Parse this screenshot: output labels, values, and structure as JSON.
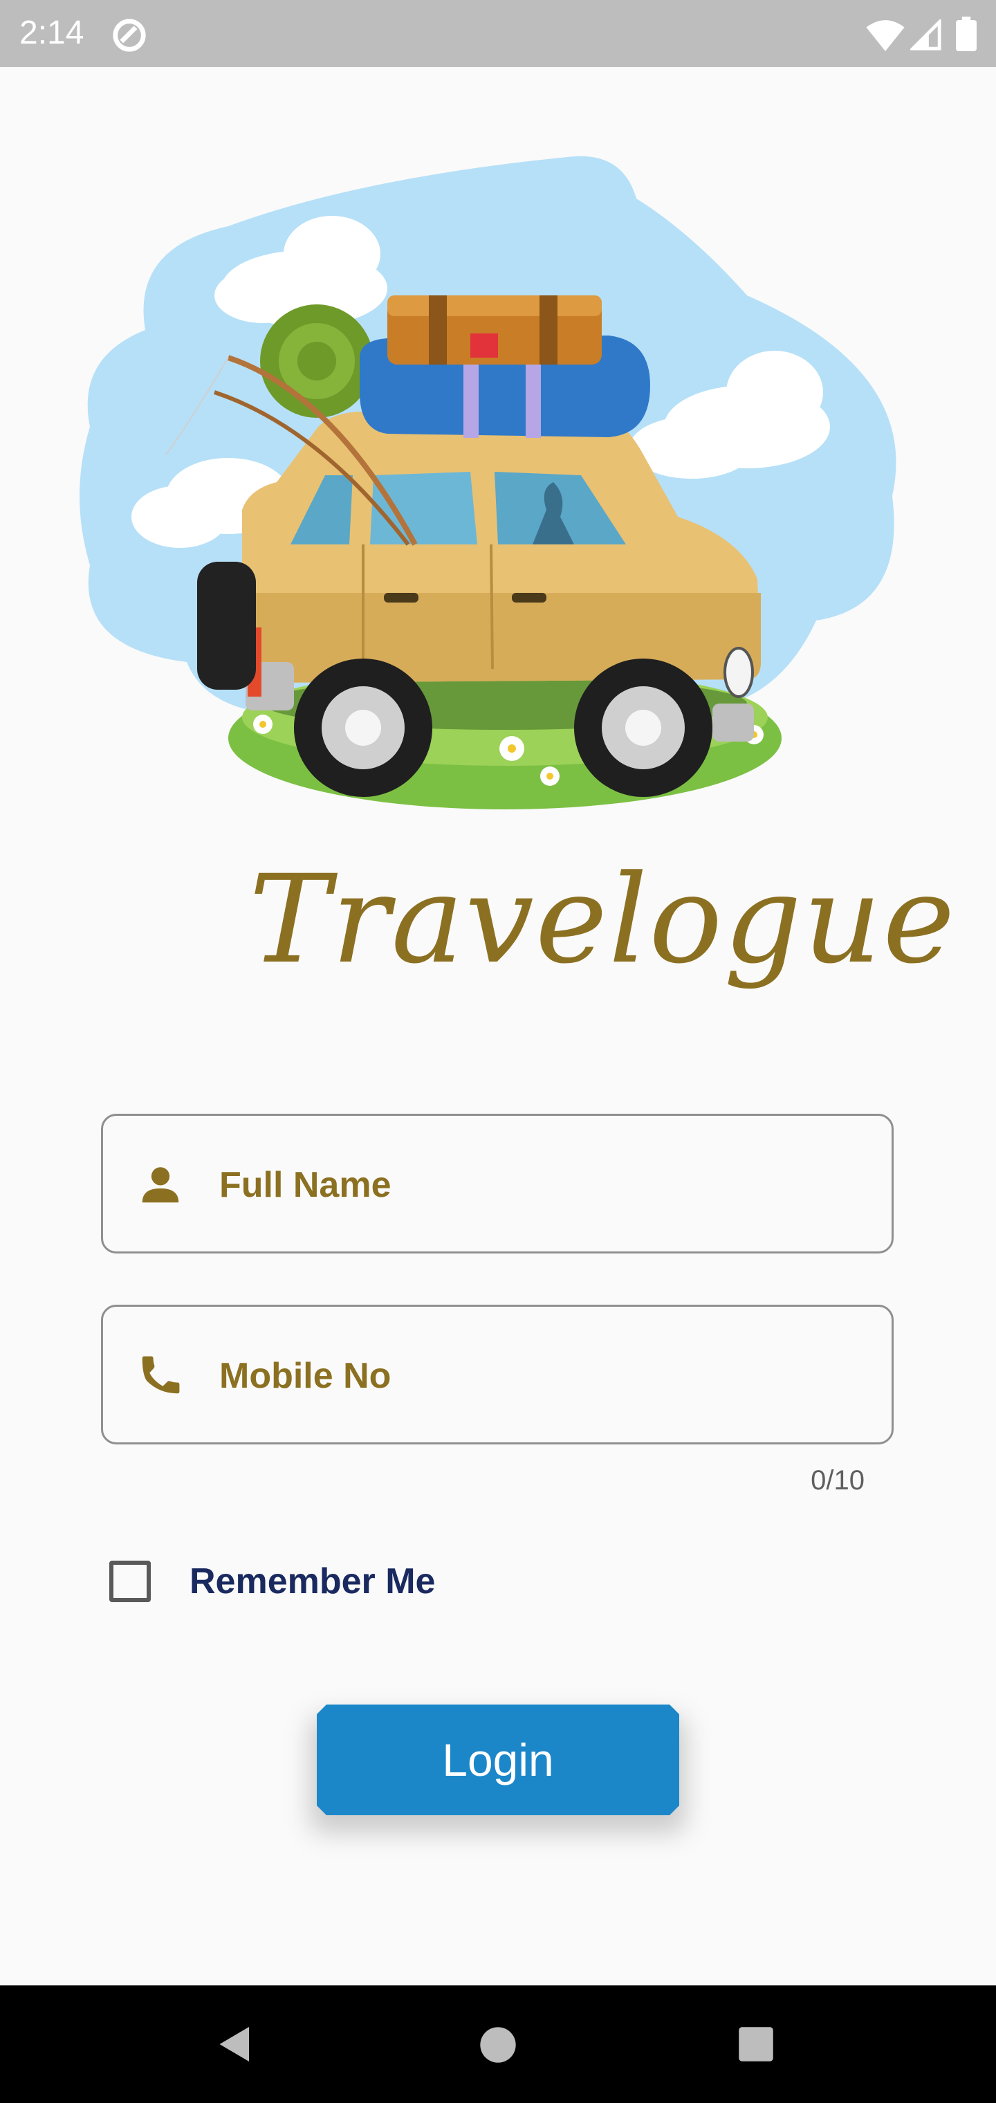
{
  "status_bar": {
    "time": "2:14",
    "icons": [
      "sync-icon",
      "wifi-icon",
      "signal-icon",
      "battery-icon"
    ]
  },
  "branding": {
    "app_name": "Travelogue",
    "hero_image": "car-with-luggage-illustration"
  },
  "form": {
    "full_name": {
      "placeholder": "Full Name",
      "icon": "person-icon"
    },
    "mobile": {
      "placeholder": "Mobile No",
      "icon": "phone-icon",
      "counter": "0/10"
    },
    "remember_me": {
      "label": "Remember Me",
      "checked": false
    },
    "login_label": "Login"
  },
  "nav_bar": {
    "icons": [
      "back-icon",
      "home-icon",
      "recents-icon"
    ]
  },
  "colors": {
    "status_bar": "#bdbdbd",
    "brand_gold": "#8c7022",
    "label_navy": "#1a2a60",
    "button_blue": "#1b87c9",
    "nav_bar": "#000000"
  }
}
